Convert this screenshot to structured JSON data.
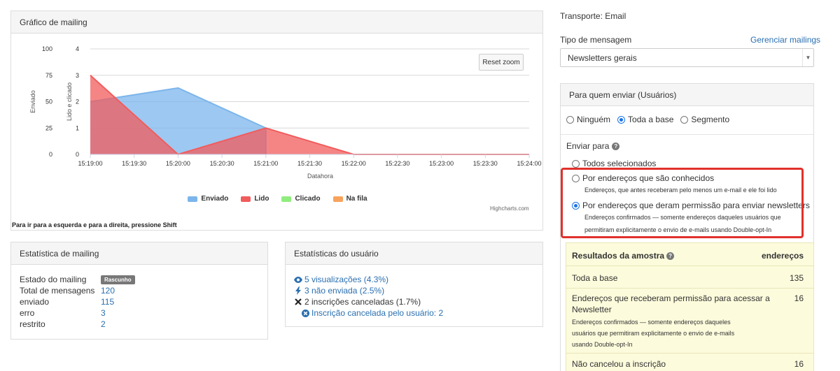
{
  "chart_panel": {
    "title": "Gráfico de mailing",
    "reset_zoom": "Reset zoom",
    "credits": "Highcharts.com",
    "shift_hint": "Para ir para a esquerda e para a direita, pressione Shift"
  },
  "chart_data": {
    "type": "area",
    "xlabel": "Datahora",
    "x": [
      "15:19:00",
      "15:19:30",
      "15:20:00",
      "15:20:30",
      "15:21:00",
      "15:21:30",
      "15:22:00",
      "15:22:30",
      "15:23:00",
      "15:23:30",
      "15:24:00"
    ],
    "xlim": [
      "15:19:00",
      "15:24:00"
    ],
    "y_axes": [
      {
        "label": "Enviado",
        "ticks": [
          0,
          25,
          50,
          75,
          100
        ],
        "ylim": [
          0,
          100
        ]
      },
      {
        "label": "Lido e clicado",
        "ticks": [
          0,
          1,
          2,
          3,
          4
        ],
        "ylim": [
          0,
          4
        ]
      }
    ],
    "grid": true,
    "legend_position": "bottom",
    "series": [
      {
        "name": "Enviado",
        "color": "#7cb5ec",
        "axis": 0,
        "points": [
          [
            "15:19:00",
            50
          ],
          [
            "15:20:00",
            63
          ],
          [
            "15:21:00",
            25
          ],
          [
            "15:21:00",
            0
          ]
        ]
      },
      {
        "name": "Lido",
        "color": "#f15c5c",
        "axis": 1,
        "points": [
          [
            "15:19:00",
            3
          ],
          [
            "15:20:00",
            0
          ],
          [
            "15:21:00",
            1
          ],
          [
            "15:22:00",
            0
          ],
          [
            "15:24:00",
            0
          ]
        ]
      },
      {
        "name": "Clicado",
        "color": "#90ed7d",
        "axis": 1,
        "points": []
      },
      {
        "name": "Na fila",
        "color": "#f7a35c",
        "axis": 1,
        "points": []
      }
    ]
  },
  "mail_stats": {
    "title": "Estatística de mailing",
    "rows": [
      {
        "key": "Estado do mailing",
        "value": "Rascunho",
        "badge": true
      },
      {
        "key": "Total de mensagens",
        "value": "120"
      },
      {
        "key": "enviado",
        "value": "115"
      },
      {
        "key": "erro",
        "value": "3"
      },
      {
        "key": "restrito",
        "value": "2"
      }
    ]
  },
  "user_stats": {
    "title": "Estatísticas do usuário",
    "views": "5 visualizações (4.3%)",
    "not_sent": "3 não enviada (2.5%)",
    "unsubscribed": "2 inscrições canceladas (1.7%)",
    "unsub_by_user": "Inscrição cancelada pelo usuário: 2"
  },
  "right": {
    "transport": "Transporte: Email",
    "message_type_label": "Tipo de mensagem",
    "manage_link": "Gerenciar mailings",
    "message_type_value": "Newsletters gerais",
    "recipients_title": "Para quem enviar (Usuários)",
    "target_options": [
      {
        "label": "Ninguém",
        "checked": false
      },
      {
        "label": "Toda a base",
        "checked": true
      },
      {
        "label": "Segmento",
        "checked": false
      }
    ],
    "send_to_label": "Enviar para",
    "send_options": [
      {
        "label": "Todos selecionados",
        "desc": "",
        "checked": false
      },
      {
        "label": "Por endereços que são conhecidos",
        "desc": "Endereços, que antes receberam pelo menos um e-mail e ele foi lido",
        "checked": false
      },
      {
        "label": "Por endereços que deram permissão para enviar newsletters",
        "desc1": "Endereços confirmados — somente endereços daqueles usuários que",
        "desc2": "permitiram explicitamente o envio de e-mails usando Double-opt-In",
        "checked": true
      }
    ],
    "highlight_color": "#e0312b"
  },
  "results": {
    "title": "Resultados da amostra",
    "col_header": "endereços",
    "rows": [
      {
        "label": "Toda a base",
        "value": "135"
      },
      {
        "label1": "Endereços que receberam permissão para acessar a",
        "label2": "Newsletter",
        "desc1": "Endereços confirmados — somente endereços daqueles",
        "desc2": "usuários que permitiram explicitamente o envio de e-mails",
        "desc3": "usando Double-opt-In",
        "value": "16"
      },
      {
        "label": "Não cancelou a inscrição",
        "value": "16"
      }
    ]
  }
}
